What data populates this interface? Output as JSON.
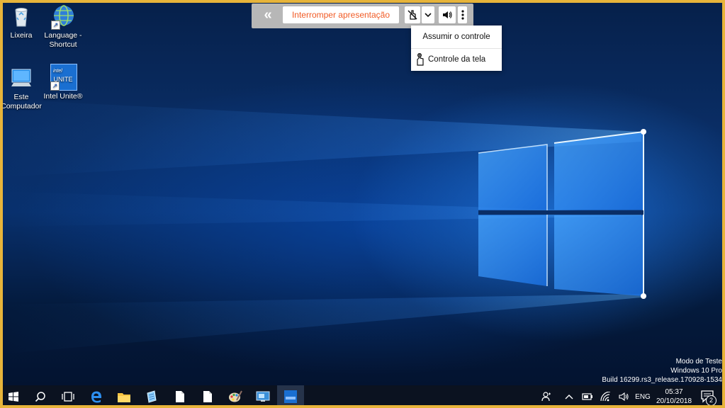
{
  "desktop": {
    "icons": [
      {
        "label": "Lixeira"
      },
      {
        "label": "Language -\nShortcut"
      },
      {
        "label": "Este\nComputador"
      },
      {
        "label": "Intel Unite®",
        "badge": "UNITE"
      }
    ]
  },
  "presentation_toolbar": {
    "back_icon": "double-chevron-left-icon",
    "stop_label": "Interromper apresentação",
    "stop_color": "#f15a24",
    "buttons": [
      "no-control-icon",
      "chevron-down-icon",
      "speaker-icon",
      "more-vertical-icon"
    ]
  },
  "control_menu": {
    "items": [
      {
        "label": "Assumir o controle"
      },
      {
        "label": "Controle da tela",
        "icon": "hand-touch-icon"
      }
    ]
  },
  "watermark": {
    "line1": "Modo de Teste",
    "line2": "Windows 10 Pro",
    "line3": "Build 16299.rs3_release.170928-1534"
  },
  "taskbar": {
    "apps": [
      "windows-start-icon",
      "search-icon",
      "task-view-icon",
      "edge-icon",
      "file-explorer-icon",
      "notepad-icon",
      "file-icon",
      "file-icon",
      "paint-icon",
      "remote-desktop-icon",
      "intel-unite-icon"
    ],
    "tray": {
      "language": "ENG",
      "time": "05:37",
      "date": "20/10/2018",
      "notifications_count": "2"
    }
  },
  "colors": {
    "frame": "#e7b43a",
    "taskbar": "#0b1220",
    "toolbar_bg": "#b7b7b7"
  }
}
